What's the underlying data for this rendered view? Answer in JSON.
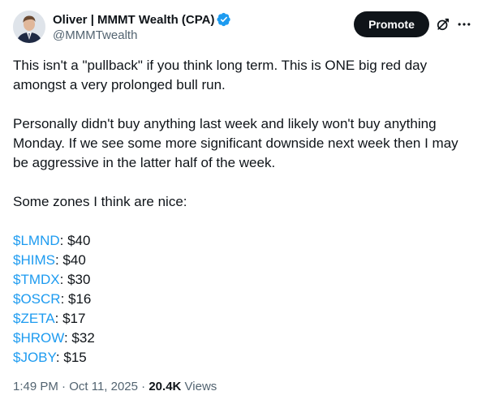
{
  "author": {
    "name": "Oliver | MMMT Wealth (CPA)",
    "handle": "@MMMTwealth",
    "verified": true,
    "verified_color": "#1d9bf0",
    "avatar_icon": "avatar-photo"
  },
  "actions": {
    "promote_label": "Promote",
    "grok_icon": "grok-icon",
    "more_icon": "more-icon"
  },
  "tweet": {
    "paragraphs": [
      "This isn't a \"pullback\" if you think long term. This is ONE big red day amongst a very prolonged bull run.",
      "Personally didn't buy anything last week and likely won't buy anything Monday. If we see some more significant downside next week then I may be aggressive in the latter half of the week.",
      "Some zones I think are nice:"
    ],
    "tickers": [
      {
        "tag": "$LMND",
        "price": ": $40"
      },
      {
        "tag": "$HIMS",
        "price": ": $40"
      },
      {
        "tag": "$TMDX",
        "price": ": $30"
      },
      {
        "tag": "$OSCR",
        "price": ": $16"
      },
      {
        "tag": "$ZETA",
        "price": ": $17"
      },
      {
        "tag": "$HROW",
        "price": ": $32"
      },
      {
        "tag": "$JOBY",
        "price": ": $15"
      }
    ],
    "cashtag_color": "#1d9bf0"
  },
  "meta": {
    "time": "1:49 PM",
    "separator": " · ",
    "date": "Oct 11, 2025",
    "views_count": "20.4K",
    "views_label": " Views"
  }
}
